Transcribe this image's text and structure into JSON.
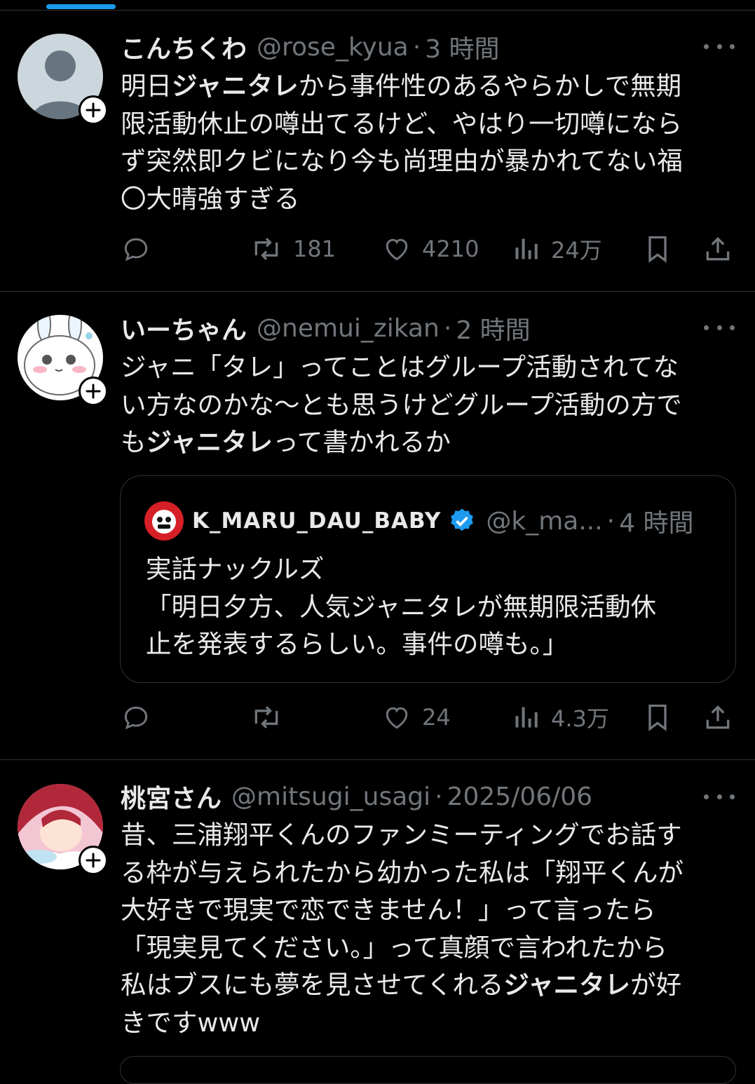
{
  "colors": {
    "accent": "#1d9bf0",
    "muted": "#71767b",
    "text": "#e7e9ea",
    "verified": "#1d9bf0"
  },
  "tweets": [
    {
      "display_name": "こんちくわ",
      "handle": "@rose_kyua",
      "dot": "·",
      "time": "3 時間",
      "lines": [
        [
          "明日",
          "ジャニタレ",
          "から事件性のあるやらかしで無期"
        ],
        [
          "限活動休止の噂出てるけど、やはり一切噂になら",
          "",
          ""
        ],
        [
          "ず突然即クビになり今も尚理由が暴かれてない福",
          "",
          ""
        ],
        [
          "〇大晴強すぎる",
          "",
          ""
        ]
      ],
      "actions": {
        "reply": "",
        "retweet": "181",
        "like": "4210",
        "views": "24万"
      }
    },
    {
      "display_name": "いーちゃん",
      "handle": "@nemui_zikan",
      "dot": "·",
      "time": "2 時間",
      "lines": [
        [
          "ジャニ「タレ」ってことはグループ活動されてな",
          "",
          ""
        ],
        [
          "い方なのかな〜とも思うけどグループ活動の方で",
          "",
          ""
        ],
        [
          "も",
          "ジャニタレ",
          "って書かれるか"
        ]
      ],
      "quote": {
        "display_name": "K_MARU_DAU_BABY",
        "handle": "@k_ma...",
        "dot": "·",
        "time": "4 時間",
        "lines": [
          "実話ナックルズ",
          "「明日夕方、人気ジャニタレが無期限活動休",
          "止を発表するらしい。事件の噂も。」"
        ]
      },
      "actions": {
        "reply": "",
        "retweet": "",
        "like": "24",
        "views": "4.3万"
      }
    },
    {
      "display_name": "桃宮さん",
      "handle": "@mitsugi_usagi",
      "dot": "·",
      "time": "2025/06/06",
      "lines": [
        [
          "昔、三浦翔平くんのファンミーティングでお話す",
          "",
          ""
        ],
        [
          "る枠が与えられたから幼かった私は「翔平くんが",
          "",
          ""
        ],
        [
          "大好きで現実で恋できません！」って言ったら",
          "",
          ""
        ],
        [
          "「現実見てください。」って真顔で言われたから",
          "",
          ""
        ],
        [
          "私はブスにも夢を見させてくれる",
          "ジャニタレ",
          "が好"
        ],
        [
          "きですwww",
          "",
          ""
        ]
      ]
    }
  ]
}
